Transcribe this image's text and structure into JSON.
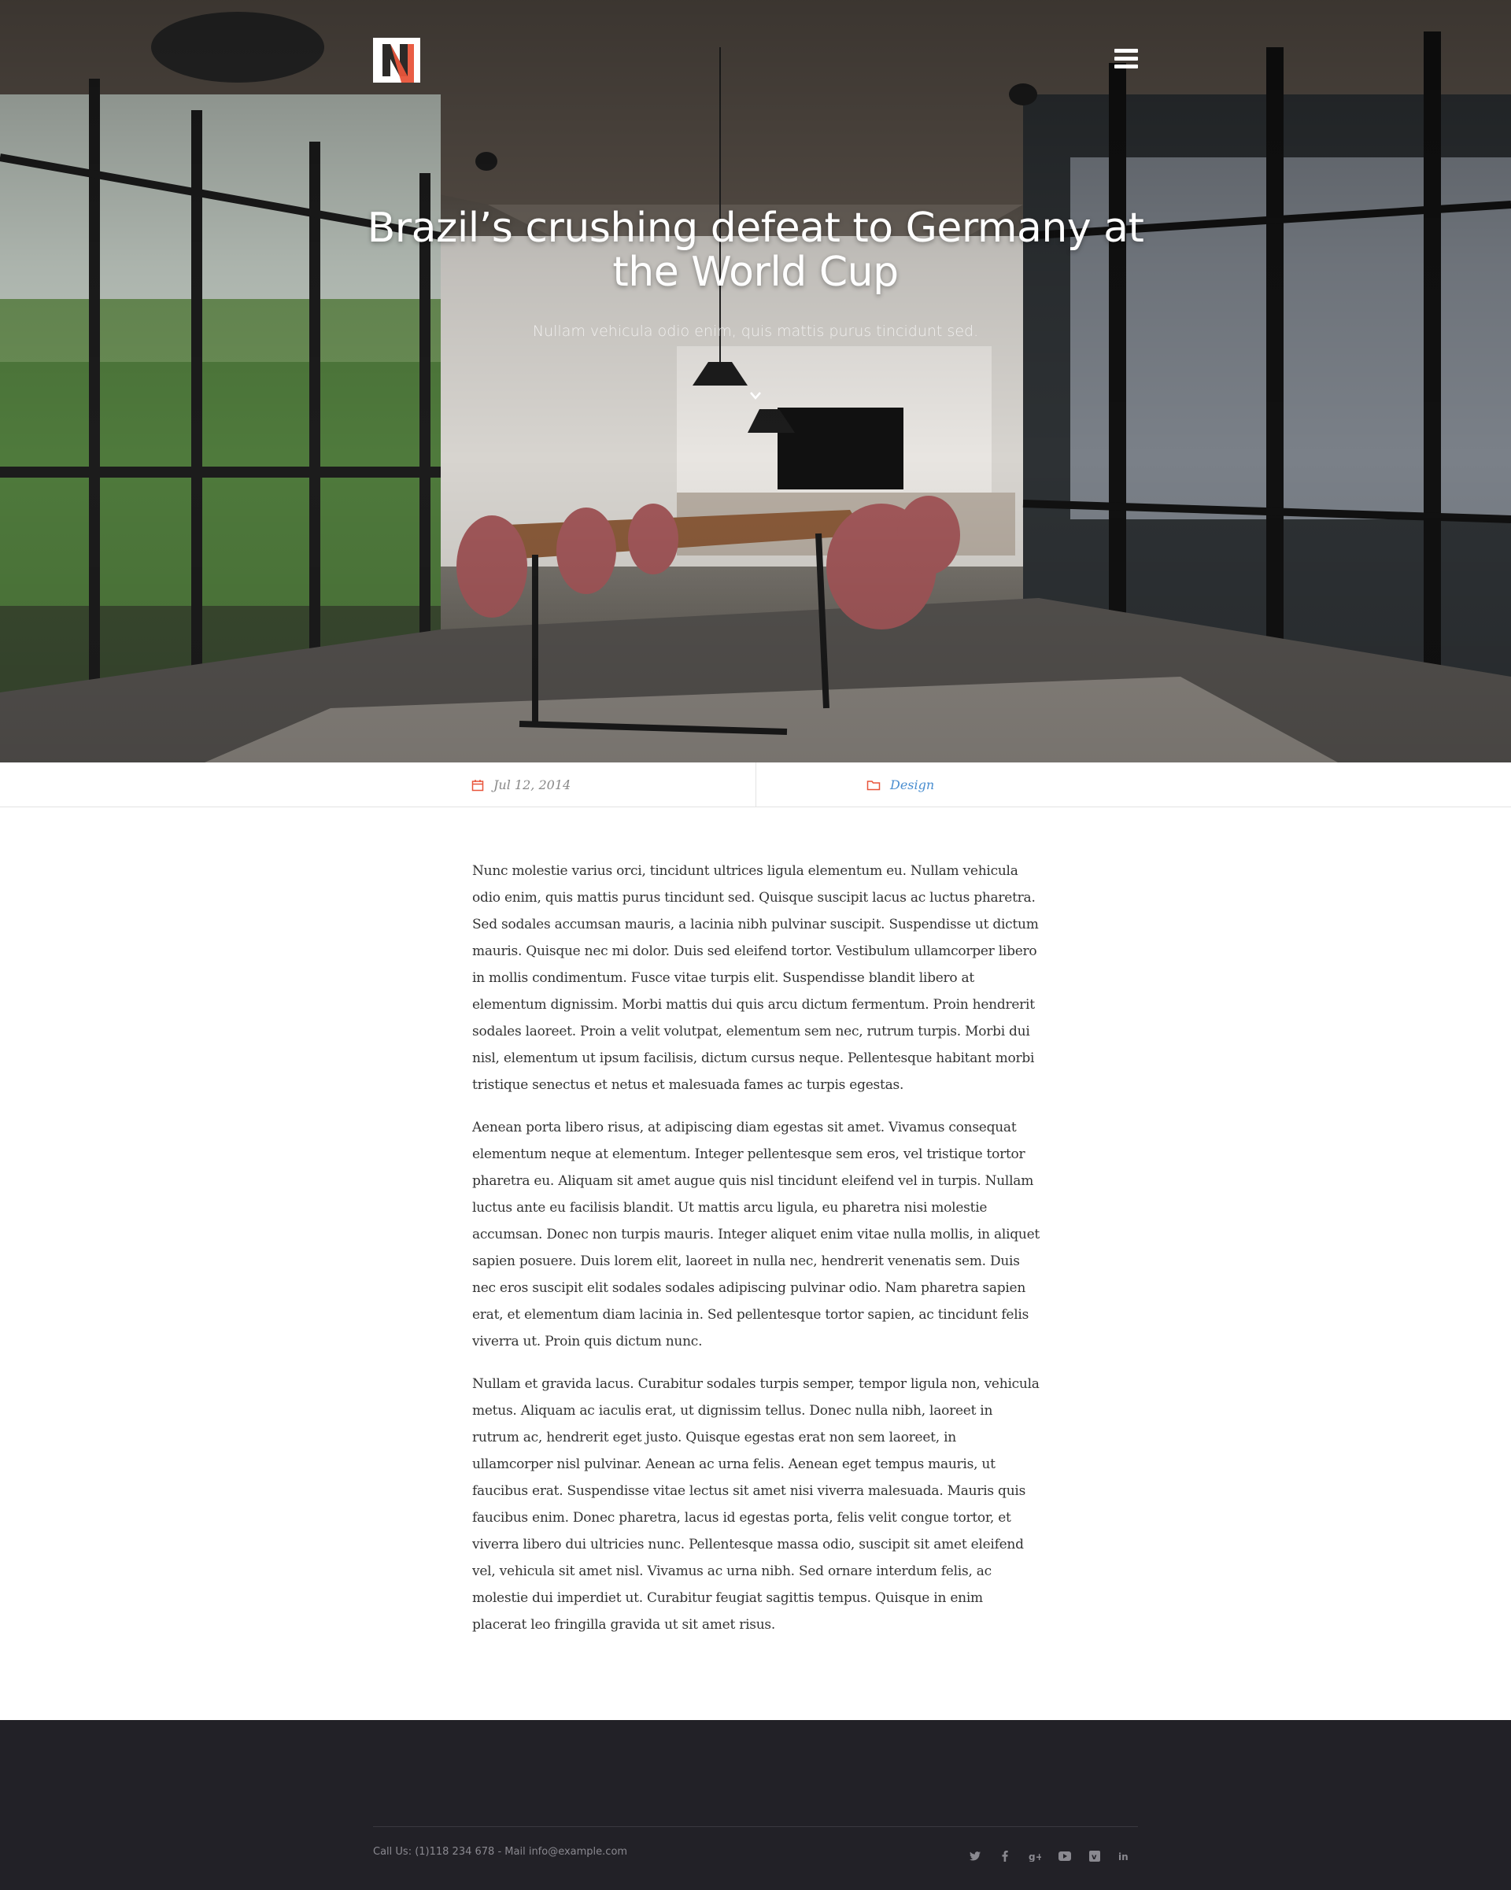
{
  "hero": {
    "title": "Brazil’s crushing defeat to Germany at the World Cup",
    "subtitle": "Nullam vehicula odio enim, quis mattis purus tincidunt sed."
  },
  "meta": {
    "date": "Jul 12, 2014",
    "category": "Design"
  },
  "article": {
    "paragraphs": [
      "Nunc molestie varius orci, tincidunt ultrices ligula elementum eu. Nullam vehicula odio enim, quis mattis purus tincidunt sed. Quisque suscipit lacus ac luctus pharetra. Sed sodales accumsan mauris, a lacinia nibh pulvinar suscipit. Suspendisse ut dictum mauris. Quisque nec mi dolor. Duis sed eleifend tortor. Vestibulum ullamcorper libero in mollis condimentum. Fusce vitae turpis elit. Suspendisse blandit libero at elementum dignissim. Morbi mattis dui quis arcu dictum fermentum. Proin hendrerit sodales laoreet. Proin a velit volutpat, elementum sem nec, rutrum turpis. Morbi dui nisl, elementum ut ipsum facilisis, dictum cursus neque. Pellentesque habitant morbi tristique senectus et netus et malesuada fames ac turpis egestas.",
      "Aenean porta libero risus, at adipiscing diam egestas sit amet. Vivamus consequat elementum neque at elementum. Integer pellentesque sem eros, vel tristique tortor pharetra eu. Aliquam sit amet augue quis nisl tincidunt eleifend vel in turpis. Nullam luctus ante eu facilisis blandit. Ut mattis arcu ligula, eu pharetra nisi molestie accumsan. Donec non turpis mauris. Integer aliquet enim vitae nulla mollis, in aliquet sapien posuere. Duis lorem elit, laoreet in nulla nec, hendrerit venenatis sem. Duis nec eros suscipit elit sodales sodales adipiscing pulvinar odio. Nam pharetra sapien erat, et elementum diam lacinia in. Sed pellentesque tortor sapien, ac tincidunt felis viverra ut. Proin quis dictum nunc.",
      "Nullam et gravida lacus. Curabitur sodales turpis semper, tempor ligula non, vehicula metus. Aliquam ac iaculis erat, ut dignissim tellus. Donec nulla nibh, laoreet in rutrum ac, hendrerit eget justo. Quisque egestas erat non sem laoreet, in ullamcorper nisl pulvinar. Aenean ac urna felis. Aenean eget tempus mauris, ut faucibus erat. Suspendisse vitae lectus sit amet nisi viverra malesuada. Mauris quis faucibus enim. Donec pharetra, lacus id egestas porta, felis velit congue tortor, et viverra libero dui ultricies nunc. Pellentesque massa odio, suscipit sit amet eleifend vel, vehicula sit amet nisl. Vivamus ac urna nibh. Sed ornare interdum felis, ac molestie dui imperdiet ut. Curabitur feugiat sagittis tempus. Quisque in enim placerat leo fringilla gravida ut sit amet risus."
    ]
  },
  "footer": {
    "call_label": "Call Us: (1)118 234 678",
    "separator": " - Mail ",
    "email": "info@example.com",
    "social": [
      "twitter-icon",
      "facebook-icon",
      "google-plus-icon",
      "youtube-icon",
      "vimeo-icon",
      "linkedin-icon"
    ]
  },
  "colors": {
    "accent": "#e8543a",
    "link": "#4a8ed0",
    "footer_bg": "#222127"
  }
}
